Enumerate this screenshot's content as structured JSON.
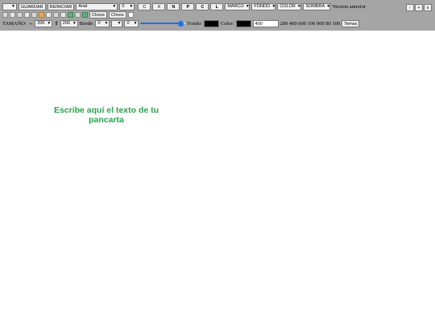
{
  "toolbar": {
    "row1": {
      "first_select": "",
      "save_label": "GUARDAR",
      "reset_label": "REINICIAR",
      "font_select": "Arial",
      "size_select": "0",
      "btn_c1": "C",
      "btn_x": "X",
      "btn_n": "N",
      "btn_p": "P",
      "btn_c2": "C",
      "btn_l": "L",
      "marco_select": "MARCO",
      "fondo_select": "FONDO",
      "color_select": "COLOR",
      "sombra_select": "SOMBRA",
      "version_text": "Version anterior",
      "win_minus": "-",
      "win_plus": "+",
      "win_close": "x"
    },
    "row2": {
      "choose1": "Choos",
      "choose2": "Choos"
    },
    "row3": {
      "tamano_label": "TAMAÑO:",
      "tamano_icon": "⇔",
      "width_select": "200",
      "height_icon": "⇕",
      "height_select": "200",
      "borde_label": "Borde:",
      "borde_select": "0",
      "borde_style_select": "",
      "extra_select": "0",
      "slider_value": 0.9,
      "fondo_label": "Fondo:",
      "fondo_color": "#000000",
      "color_label": "Color:",
      "color_color": "#000000",
      "weight_value": "400",
      "weights_text": "200 400 600 100 900 80 100",
      "temas_label": "Temas"
    }
  },
  "canvas": {
    "title_text": "Escribe aquí el texto de tu pancarta",
    "title_color": "#2aa34a"
  }
}
